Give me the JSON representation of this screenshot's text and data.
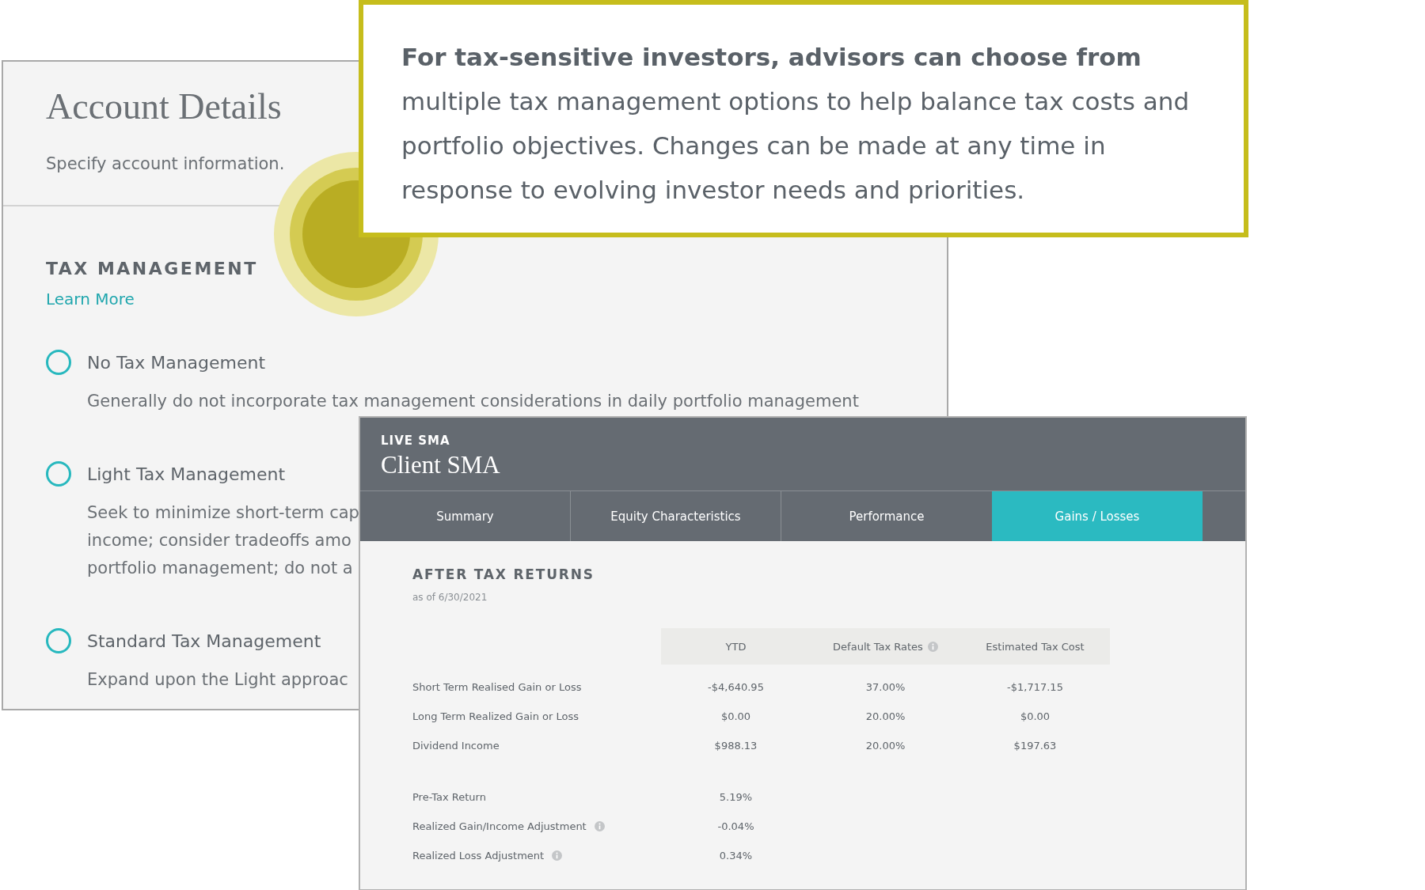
{
  "account_details": {
    "title": "Account Details",
    "subtitle": "Specify account information.",
    "section_title": "TAX MANAGEMENT",
    "learn_more": "Learn More",
    "options": [
      {
        "label": "No Tax Management",
        "selected": false,
        "description_lines": [
          "Generally do not incorporate tax management considerations in daily portfolio management"
        ]
      },
      {
        "label": "Light Tax Management",
        "selected": false,
        "description_lines": [
          "Seek to minimize short-term cap",
          "income; consider tradeoffs amo",
          "portfolio management; do not a"
        ]
      },
      {
        "label": "Standard Tax Management",
        "selected": false,
        "description_lines": [
          "Expand upon the Light approac"
        ]
      }
    ]
  },
  "callout": {
    "text": "**For tax-sensitive investors, advisors can choose from** multiple tax management options to help balance tax costs and portfolio objectives. Changes can be made at any time in response to evolving investor needs and priorities."
  },
  "sma_panel": {
    "eyebrow": "LIVE SMA",
    "title": "Client SMA",
    "tabs": [
      {
        "label": "Summary",
        "selected": false
      },
      {
        "label": "Equity Characteristics",
        "selected": false
      },
      {
        "label": "Performance",
        "selected": false
      },
      {
        "label": "Gains / Losses",
        "selected": true
      }
    ],
    "section_title": "AFTER TAX RETURNS",
    "as_of": "as of 6/30/2021",
    "table": {
      "columns": [
        {
          "label": "YTD",
          "info": false
        },
        {
          "label": "Default Tax Rates",
          "info": true
        },
        {
          "label": "Estimated Tax Cost",
          "info": false
        }
      ],
      "row_groups": [
        [
          {
            "label": "Short Term Realised Gain or Loss",
            "info": false,
            "cells": [
              "-$4,640.95",
              "37.00%",
              "-$1,717.15"
            ]
          },
          {
            "label": "Long Term Realized Gain or Loss",
            "info": false,
            "cells": [
              "$0.00",
              "20.00%",
              "$0.00"
            ]
          },
          {
            "label": "Dividend Income",
            "info": false,
            "cells": [
              "$988.13",
              "20.00%",
              "$197.63"
            ]
          }
        ],
        [
          {
            "label": "Pre-Tax Return",
            "info": false,
            "cells": [
              "5.19%"
            ]
          },
          {
            "label": "Realized Gain/Income Adjustment",
            "info": true,
            "cells": [
              "-0.04%"
            ]
          },
          {
            "label": "Realized Loss Adjustment",
            "info": true,
            "cells": [
              "0.34%"
            ]
          }
        ]
      ]
    }
  }
}
